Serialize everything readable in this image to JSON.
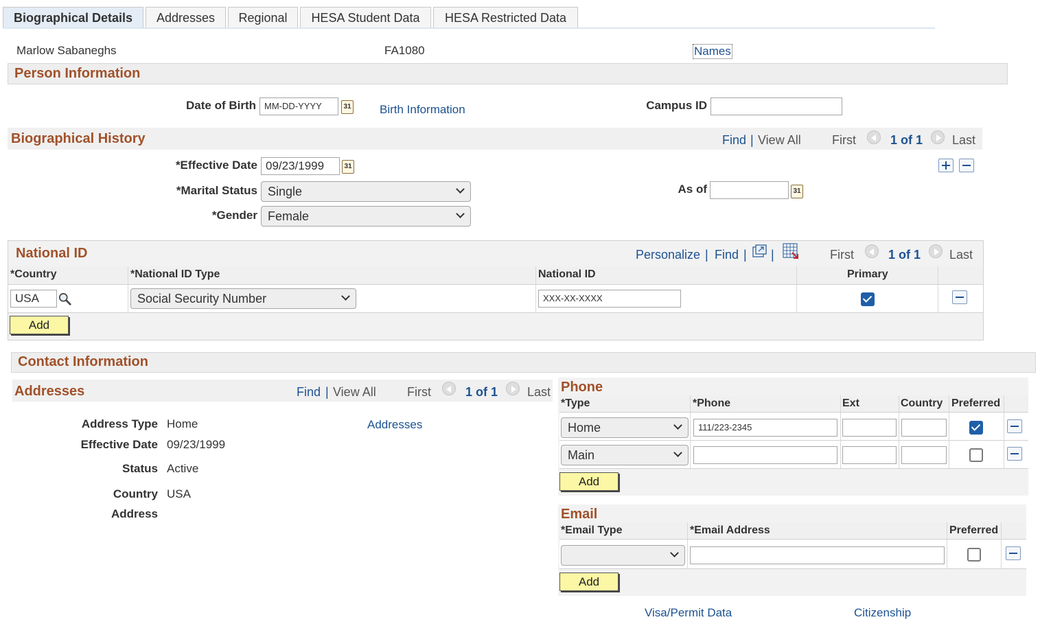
{
  "tabs": [
    {
      "label": "Biographical Details"
    },
    {
      "label": "Addresses"
    },
    {
      "label": "Regional"
    },
    {
      "label": "HESA Student Data"
    },
    {
      "label": "HESA Restricted Data"
    }
  ],
  "header": {
    "person_name": "Marlow Sabaneghs",
    "person_id": "FA1080",
    "names_link": "Names"
  },
  "person_info": {
    "title": "Person Information",
    "dob_label": "Date of Birth",
    "dob_value": "MM-DD-YYYY",
    "birth_info_link": "Birth Information",
    "campus_id_label": "Campus ID",
    "campus_id_value": ""
  },
  "bio_history": {
    "title": "Biographical History",
    "find": "Find",
    "sep": "|",
    "view_all": "View All",
    "first": "First",
    "page": "1 of 1",
    "last": "Last",
    "eff_date_label": "*Effective Date",
    "eff_date_value": "09/23/1999",
    "marital_label": "*Marital Status",
    "marital_value": "Single",
    "gender_label": "*Gender",
    "gender_value": "Female",
    "as_of_label": "As of",
    "as_of_value": ""
  },
  "national_id": {
    "title": "National ID",
    "personalize": "Personalize",
    "sep": "|",
    "find": "Find",
    "first": "First",
    "page": "1 of 1",
    "last": "Last",
    "columns": {
      "country": "*Country",
      "type": "*National ID Type",
      "nid": "National ID",
      "primary": "Primary"
    },
    "row": {
      "country": "USA",
      "type": "Social Security Number",
      "nid": "XXX-XX-XXXX",
      "primary": true
    },
    "add": "Add"
  },
  "contact": {
    "title": "Contact Information",
    "addresses": {
      "title": "Addresses",
      "find": "Find",
      "sep": "|",
      "view_all": "View All",
      "first": "First",
      "page": "1 of 1",
      "last": "Last",
      "address_type_label": "Address Type",
      "address_type_value": "Home",
      "eff_date_label": "Effective Date",
      "eff_date_value": "09/23/1999",
      "status_label": "Status",
      "status_value": "Active",
      "country_label": "Country",
      "country_value": "USA",
      "address_label": "Address",
      "addresses_link": "Addresses"
    },
    "phone": {
      "title": "Phone",
      "columns": {
        "type": "*Type",
        "phone": "*Phone",
        "ext": "Ext",
        "country": "Country",
        "preferred": "Preferred"
      },
      "rows": [
        {
          "type": "Home",
          "phone": "111/223-2345",
          "ext": "",
          "country": "",
          "preferred": true
        },
        {
          "type": "Main",
          "phone": "",
          "ext": "",
          "country": "",
          "preferred": false
        }
      ],
      "add": "Add"
    },
    "email": {
      "title": "Email",
      "columns": {
        "type": "*Email Type",
        "address": "*Email Address",
        "preferred": "Preferred"
      },
      "row": {
        "type": "",
        "address": "",
        "preferred": false
      },
      "add": "Add"
    },
    "visa_link": "Visa/Permit Data",
    "citizenship_link": "Citizenship"
  }
}
